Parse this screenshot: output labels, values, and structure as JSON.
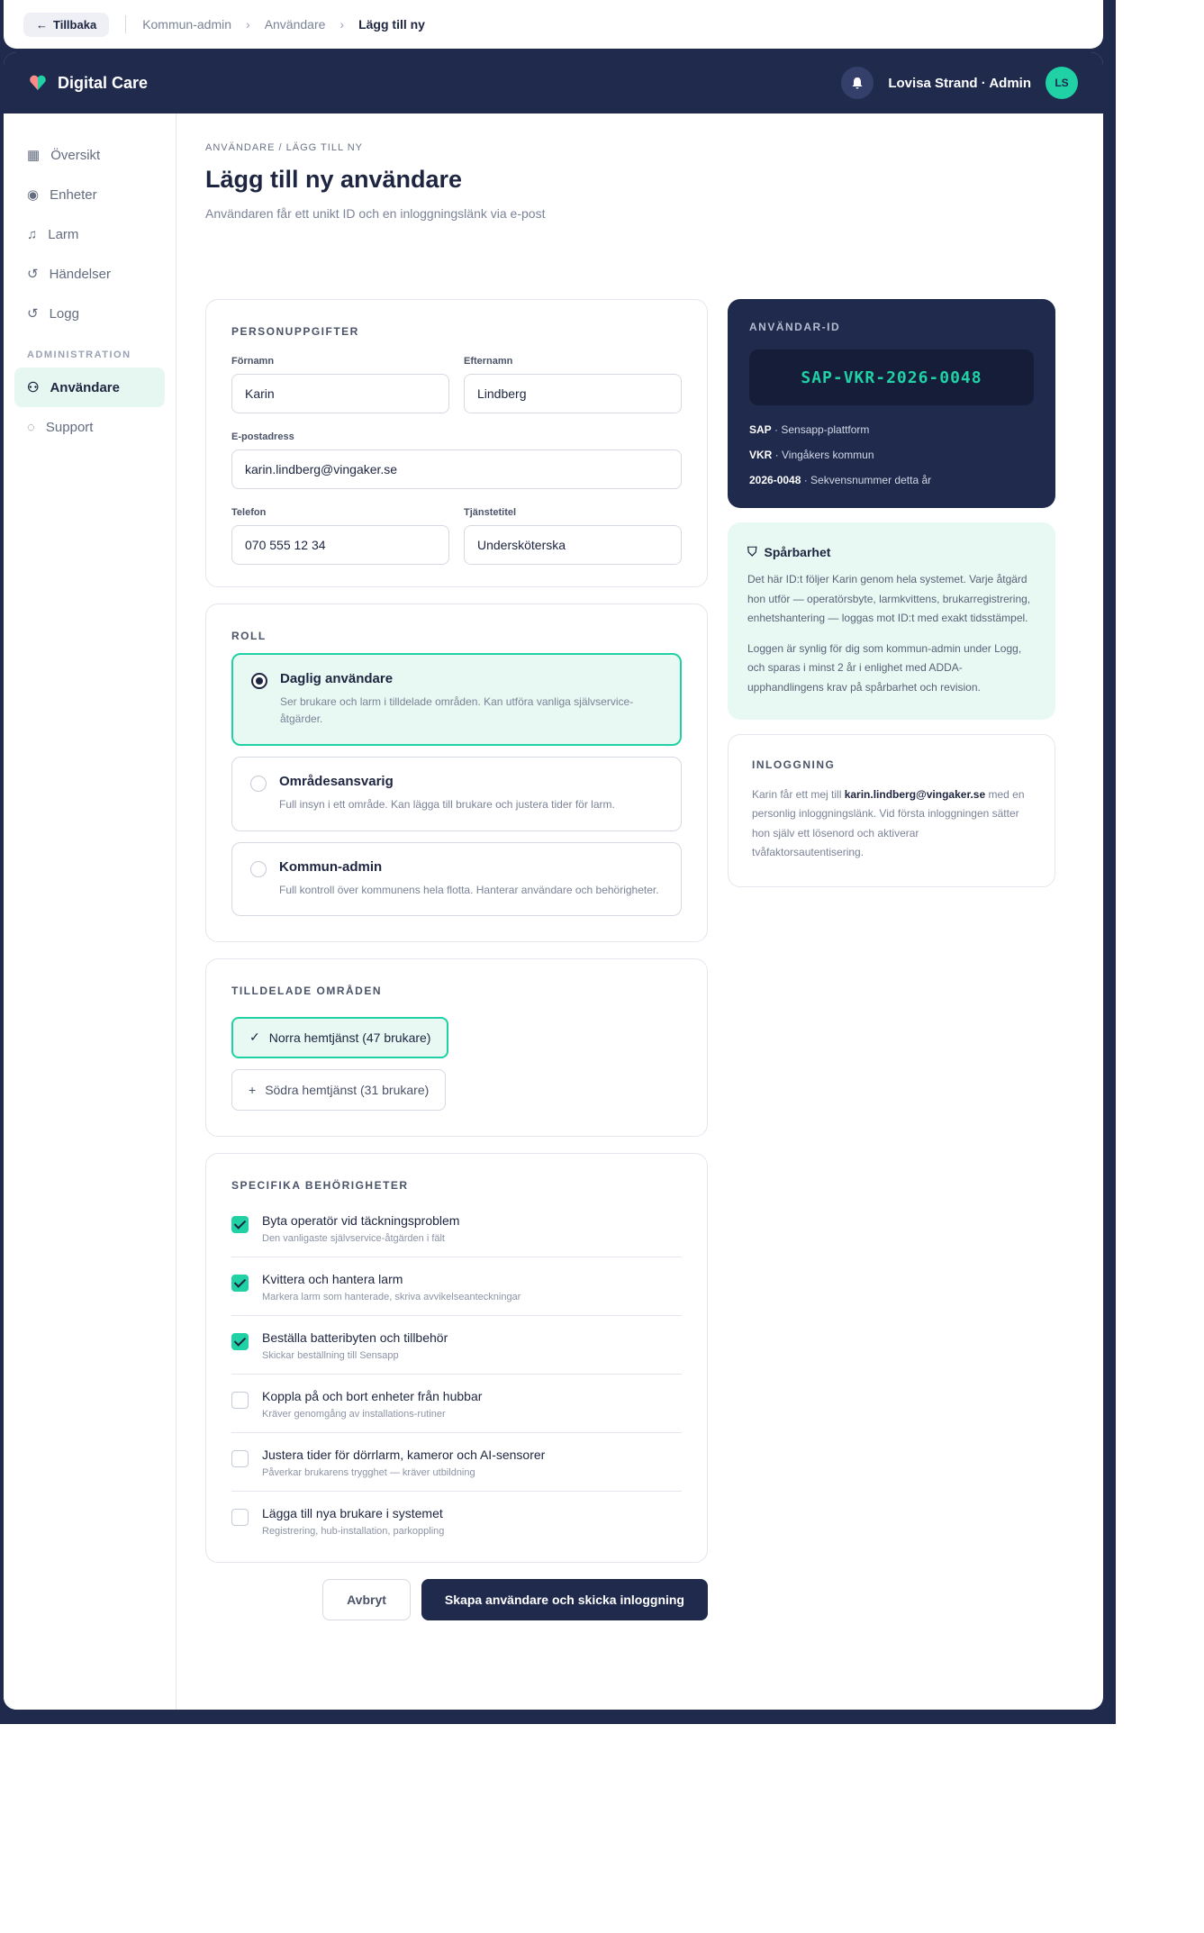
{
  "topnav": {
    "back_label": "Tillbaka",
    "crumbs": [
      "Kommun-admin",
      "Användare",
      "Lägg till ny"
    ]
  },
  "header": {
    "brand": "Digital Care",
    "user": "Lovisa Strand · Admin",
    "avatar_initials": "LS"
  },
  "sidebar": {
    "items": [
      "Översikt",
      "Enheter",
      "Larm",
      "Händelser",
      "Logg"
    ],
    "section_label": "ADMINISTRATION",
    "admin_items": [
      "Användare",
      "Support"
    ]
  },
  "page": {
    "breadcrumb": "ANVÄNDARE / LÄGG TILL NY",
    "title": "Lägg till ny användare",
    "subtitle": "Användaren får ett unikt ID och en inloggningslänk via e-post"
  },
  "personal": {
    "title": "PERSONUPPGIFTER",
    "first_name_label": "Förnamn",
    "first_name": "Karin",
    "last_name_label": "Efternamn",
    "last_name": "Lindberg",
    "email_label": "E-postadress",
    "email": "karin.lindberg@vingaker.se",
    "phone_label": "Telefon",
    "phone": "070 555 12 34",
    "title_label": "Tjänstetitel",
    "job_title": "Undersköterska"
  },
  "role": {
    "title": "ROLL",
    "options": [
      {
        "label": "Daglig användare",
        "desc": "Ser brukare och larm i tilldelade områden. Kan utföra vanliga självservice-åtgärder."
      },
      {
        "label": "Områdesansvarig",
        "desc": "Full insyn i ett område. Kan lägga till brukare och justera tider för larm."
      },
      {
        "label": "Kommun-admin",
        "desc": "Full kontroll över kommunens hela flotta. Hanterar användare och behörigheter."
      }
    ]
  },
  "areas": {
    "title": "TILLDELADE OMRÅDEN",
    "selected": "Norra hemtjänst (47 brukare)",
    "unselected": "Södra hemtjänst (31 brukare)"
  },
  "permissions": {
    "title": "SPECIFIKA BEHÖRIGHETER",
    "items": [
      {
        "label": "Byta operatör vid täckningsproblem",
        "desc": "Den vanligaste självservice-åtgärden i fält"
      },
      {
        "label": "Kvittera och hantera larm",
        "desc": "Markera larm som hanterade, skriva avvikelseanteckningar"
      },
      {
        "label": "Beställa batteribyten och tillbehör",
        "desc": "Skickar beställning till Sensapp"
      },
      {
        "label": "Koppla på och bort enheter från hubbar",
        "desc": "Kräver genomgång av installations-rutiner"
      },
      {
        "label": "Justera tider för dörrlarm, kameror och AI-sensorer",
        "desc": "Påverkar brukarens trygghet — kräver utbildning"
      },
      {
        "label": "Lägga till nya brukare i systemet",
        "desc": "Registrering, hub-installation, parkoppling"
      }
    ]
  },
  "actions": {
    "cancel": "Avbryt",
    "submit": "Skapa användare och skicka inloggning"
  },
  "user_id": {
    "title": "ANVÄNDAR-ID",
    "id": "SAP-VKR-2026-0048",
    "lines": [
      {
        "key": "SAP",
        "value": " · Sensapp-plattform"
      },
      {
        "key": "VKR",
        "value": " · Vingåkers kommun"
      },
      {
        "key": "2026-0048",
        "value": " · Sekvensnummer detta år"
      }
    ]
  },
  "traceability": {
    "title": "Spårbarhet",
    "p1": "Det här ID:t följer Karin genom hela systemet. Varje åtgärd hon utför — operatörsbyte, larmkvittens, brukarregistrering, enhetshantering — loggas mot ID:t med exakt tidsstämpel.",
    "p2": "Loggen är synlig för dig som kommun-admin under Logg, och sparas i minst 2 år i enlighet med ADDA-upphandlingens krav på spårbarhet och revision."
  },
  "login": {
    "title": "INLOGGNING",
    "p_before": "Karin får ett mej till ",
    "email": "karin.lindberg@vingaker.se",
    "p_after": " med en personlig inloggningslänk. Vid första inloggningen sätter hon själv ett lösenord och aktiverar tvåfaktorsautentisering."
  },
  "colors": {
    "navy": "#1f2a4d",
    "accent": "#1fd1a5",
    "accent_bg": "#e8f8f2"
  }
}
